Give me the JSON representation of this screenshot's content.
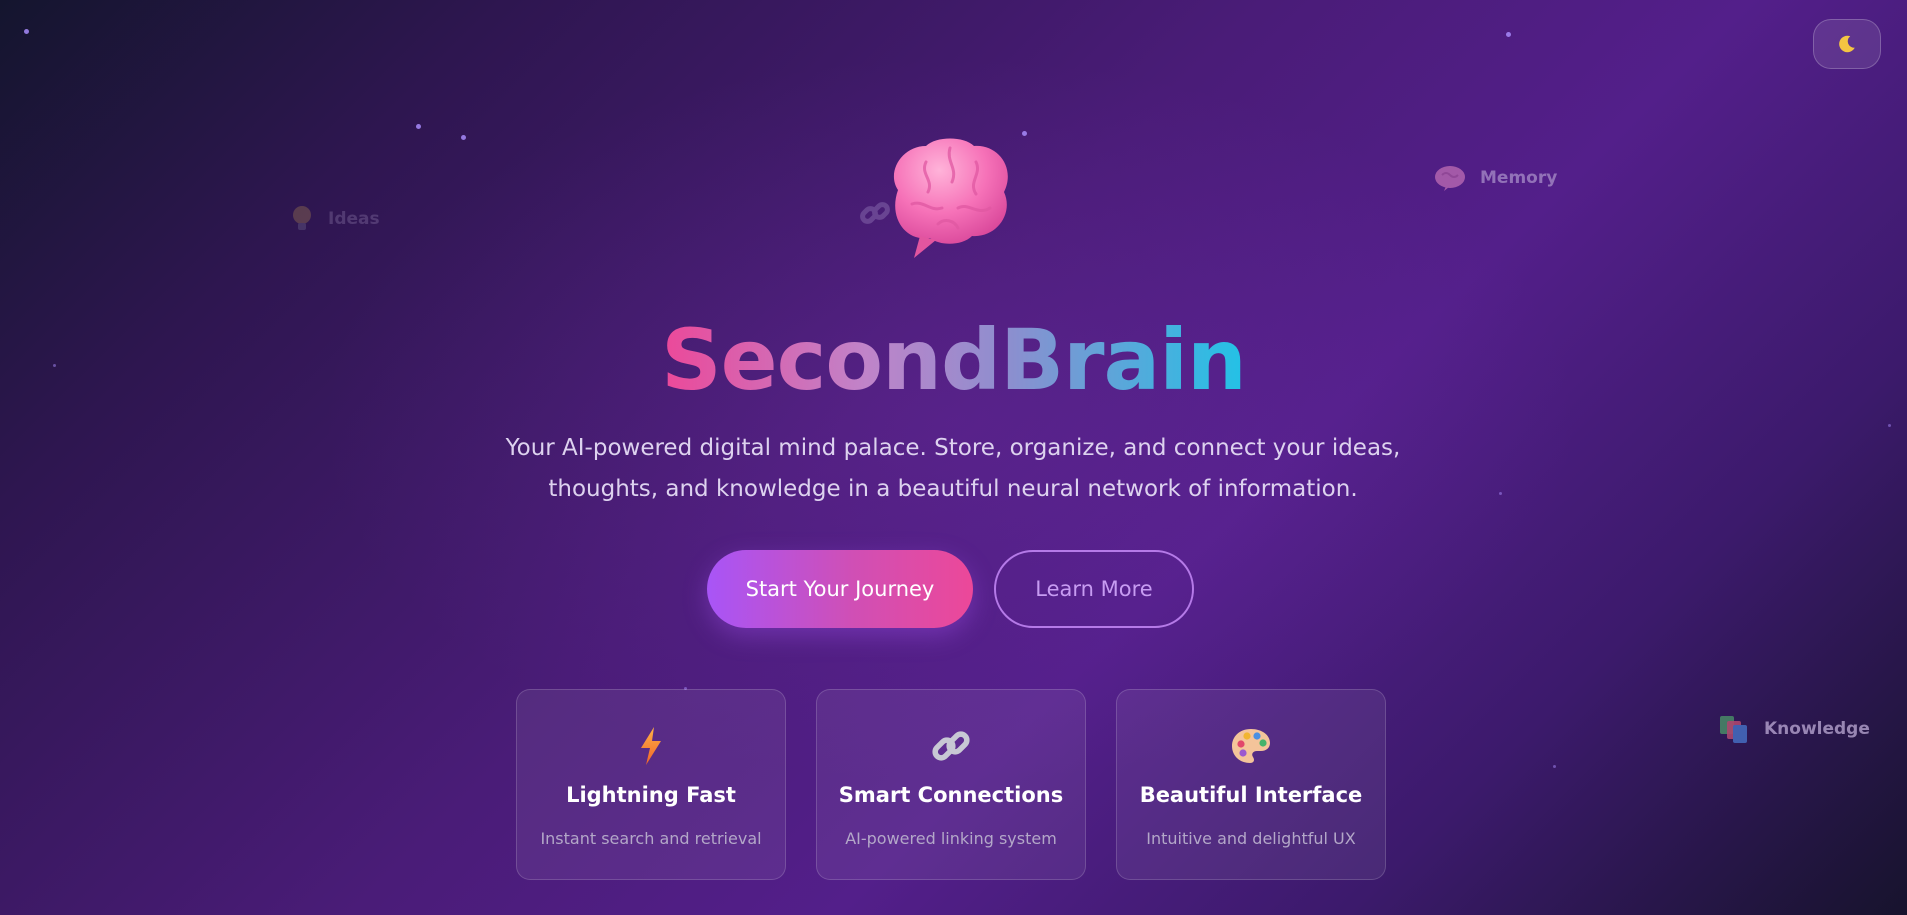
{
  "theme_toggle": {
    "icon": "moon-icon"
  },
  "floating_tags": {
    "ideas": {
      "label": "Ideas",
      "icon": "lightbulb-icon"
    },
    "memory": {
      "label": "Memory",
      "icon": "brain-icon"
    },
    "knowledge": {
      "label": "Knowledge",
      "icon": "books-icon"
    }
  },
  "hero": {
    "icon": "brain-icon",
    "title": "SecondBrain",
    "subtitle_line1": "Your AI-powered digital mind palace. Store, organize, and connect your ideas,",
    "subtitle_line2": "thoughts, and knowledge in a beautiful neural network of information.",
    "primary_button": "Start Your Journey",
    "secondary_button": "Learn More"
  },
  "features": [
    {
      "icon": "lightning-icon",
      "title": "Lightning Fast",
      "description": "Instant search and retrieval"
    },
    {
      "icon": "link-icon",
      "title": "Smart Connections",
      "description": "AI-powered linking system"
    },
    {
      "icon": "palette-icon",
      "title": "Beautiful Interface",
      "description": "Intuitive and delightful UX"
    }
  ],
  "colors": {
    "title_gradient_start": "#ec4899",
    "title_gradient_end": "#22c2e6",
    "primary_button_start": "#a855f7",
    "primary_button_end": "#ec4899",
    "background": "#4a1c78"
  }
}
